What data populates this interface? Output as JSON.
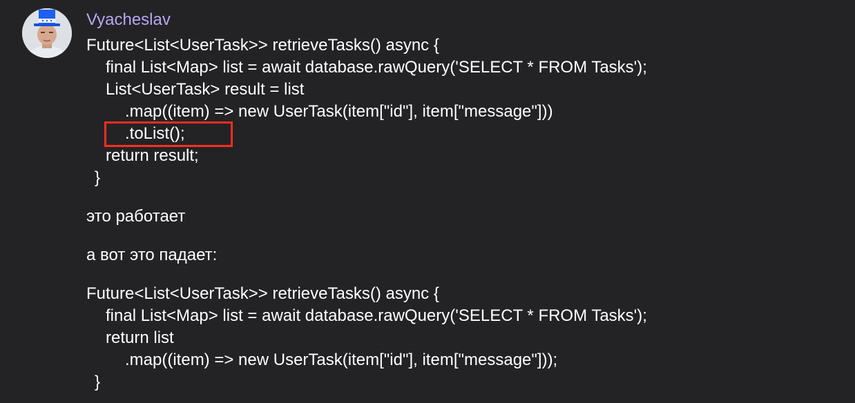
{
  "message": {
    "author": "Vyacheslav",
    "code_block_1": [
      "Future<List<UserTask>> retrieveTasks() async {",
      "final List<Map> list = await database.rawQuery('SELECT * FROM Tasks');",
      "List<UserTask> result = list",
      ".map((item) => new UserTask(item[\"id\"], item[\"message\"]))",
      ".toList();",
      "return result;",
      "}"
    ],
    "text_1": "это работает",
    "text_2": "а вот это падает:",
    "code_block_2": [
      "Future<List<UserTask>> retrieveTasks() async {",
      "final List<Map> list = await database.rawQuery('SELECT * FROM Tasks');",
      "return list",
      ".map((item) => new UserTask(item[\"id\"], item[\"message\"]));",
      "}"
    ]
  },
  "colors": {
    "background": "#232326",
    "author_name": "#b9a7f2",
    "text": "#ffffff",
    "highlight_box": "#ff2d1d"
  },
  "icons": {
    "avatar": "user-avatar-top-hat"
  }
}
